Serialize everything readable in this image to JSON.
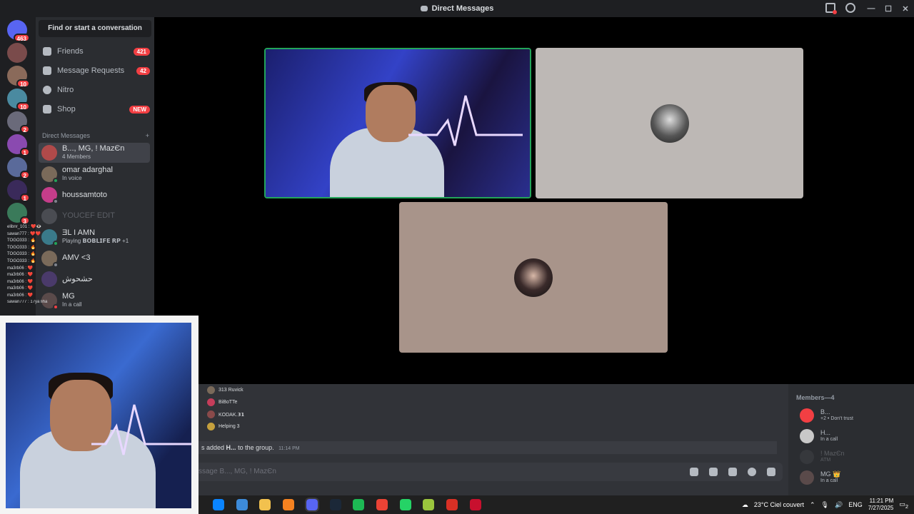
{
  "window": {
    "title": "Direct Messages"
  },
  "servers": [
    {
      "badge": "463",
      "color": "#5865f2"
    },
    {
      "badge": "",
      "color": "#7a4b4b"
    },
    {
      "badge": "10",
      "color": "#8a6a5a"
    },
    {
      "badge": "10",
      "color": "#4a8aa0"
    },
    {
      "badge": "2",
      "color": "#6a6a7a"
    },
    {
      "badge": "1",
      "color": "#8a4ab0"
    },
    {
      "badge": "2",
      "color": "#5a6a9a"
    },
    {
      "badge": "1",
      "color": "#3a2a5a"
    },
    {
      "badge": "3",
      "color": "#3a7a5a"
    }
  ],
  "sidebar": {
    "search_label": "Find or start a conversation",
    "nav": [
      {
        "label": "Friends",
        "badge": "421"
      },
      {
        "label": "Message Requests",
        "badge": "42"
      },
      {
        "label": "Nitro",
        "badge": ""
      },
      {
        "label": "Shop",
        "badge": "NEW"
      }
    ],
    "dm_header": "Direct Messages",
    "dm_add": "+",
    "dms": [
      {
        "name": "B..., MG, ! MazЄn",
        "sub": "4 Members",
        "color": "#b04a4a",
        "status": ""
      },
      {
        "name": "omar adarghal",
        "sub": "In voice",
        "color": "#7a6a5a",
        "status": "#23a55a"
      },
      {
        "name": "houssamtoto",
        "sub": "",
        "color": "#c53d8a",
        "status": "#80848e"
      },
      {
        "name": "YOUCEF EDIT",
        "sub": "",
        "color": "#4a4c52",
        "status": ""
      },
      {
        "name": "ƎL I AMN",
        "sub": "Playing 𝗕𝗢𝗕𝗟𝗜𝗙𝗘 𝗥𝗣 +1",
        "color": "#3a7a8a",
        "status": "#23a55a"
      },
      {
        "name": "AMV <3",
        "sub": "",
        "color": "#7a6a5a",
        "status": "#80848e"
      },
      {
        "name": "حشحوش",
        "sub": "",
        "color": "#4a3a6a",
        "status": ""
      },
      {
        "name": "MG",
        "sub": "In a call",
        "color": "#5a4a4a",
        "status": "#f23f43"
      }
    ]
  },
  "chat_overlay": [
    "elibnr_101 : ❤️👁️",
    "sawan777 : ❤️❤️",
    "TOGO333 : 🔥",
    "TOGO333 : 🔥",
    "TOGO333 : 🔥",
    "TOGO333 : 🔥",
    "ma3rb06 : ❤️",
    "ma3rb06 : ❤️",
    "ma3rb06 : ❤️",
    "ma3rb06 : ❤️",
    "ma3rb06 : ❤️",
    "sawan777 : 17ya liha"
  ],
  "call_tiles": [
    {
      "kind": "video",
      "border": "#23a55a"
    },
    {
      "kind": "avatar",
      "bg": "#bdb8b5"
    },
    {
      "kind": "avatar",
      "bg": "#a8948a"
    }
  ],
  "typing": [
    {
      "name": "313 Ruvick",
      "color": "#7a6a5a"
    },
    {
      "name": "BiBoTTe",
      "color": "#c53d5a"
    },
    {
      "name": "KODAK.𝟯𝟭",
      "color": "#8a4a4a"
    },
    {
      "name": "Helping 3",
      "color": "#c5a03d"
    }
  ],
  "system_message": {
    "text_prefix": "s added",
    "target": "H...",
    "text_suffix": "to the group.",
    "time": "11:14 PM"
  },
  "composer": {
    "placeholder": "ssage B..., MG, ! MazЄn"
  },
  "members": {
    "header": "Members—4",
    "list": [
      {
        "name": "B...",
        "sub": "+2 • Don't trust",
        "color": "#f23f43"
      },
      {
        "name": "H...",
        "sub": "In a call",
        "color": "#c8c8c8"
      },
      {
        "name": "! MazЄn",
        "sub": "ATM",
        "color": "#4a4c52"
      },
      {
        "name": "MG 👑",
        "sub": "In a call",
        "color": "#5a4a4a"
      }
    ]
  },
  "taskbar": {
    "weather": "23°C  Ciel couvert",
    "lang": "ENG",
    "time": "11:21 PM",
    "date": "7/27/2025",
    "notif": "2",
    "apps": [
      "#0a84ff",
      "#3d8bd9",
      "#f2c14e",
      "#f58220",
      "#5865f2",
      "#1b2838",
      "#1db954",
      "#ea4335",
      "#25d366",
      "#9bc53d",
      "#d93025",
      "#c8102e"
    ]
  }
}
